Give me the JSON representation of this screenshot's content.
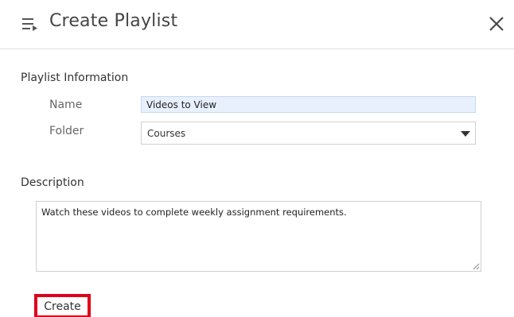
{
  "header": {
    "title": "Create Playlist",
    "icon": "playlist-icon",
    "close_icon": "close-icon"
  },
  "playlist_info": {
    "section_title": "Playlist Information",
    "name_label": "Name",
    "name_value": "Videos to View",
    "folder_label": "Folder",
    "folder_value": "Courses"
  },
  "description": {
    "section_title": "Description",
    "value": "Watch these videos to complete weekly assignment requirements."
  },
  "actions": {
    "create_label": "Create",
    "highlight_color": "#e0001b"
  },
  "colors": {
    "name_input_background": "#e8f0fe",
    "divider": "#e2e2e2",
    "text": "#333333"
  }
}
